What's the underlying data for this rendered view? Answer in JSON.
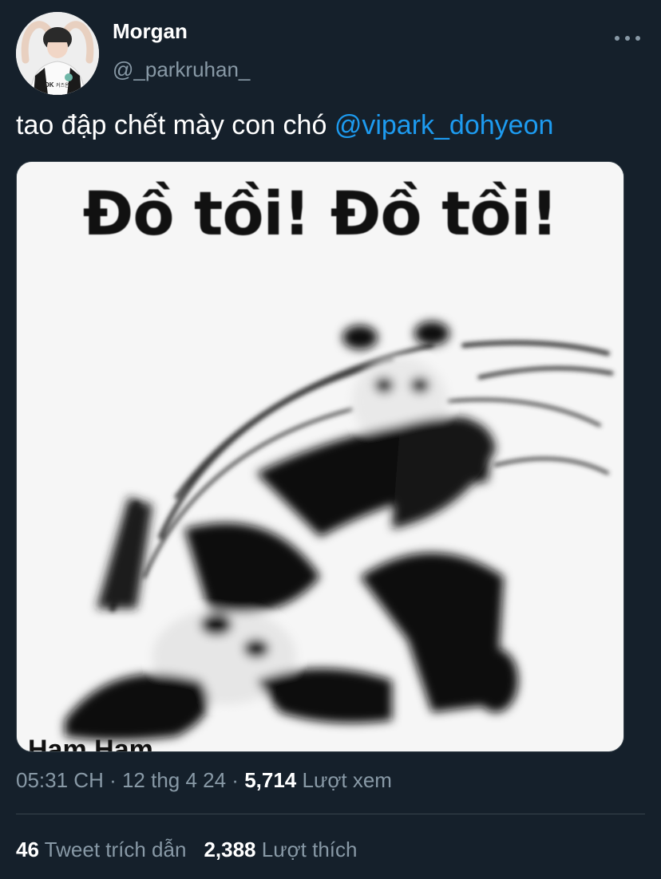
{
  "author": {
    "display_name": "Morgan",
    "handle": "@_parkruhan_",
    "avatar_jersey_text": "DK",
    "avatar_jersey_name": "커즈온"
  },
  "more_icon": "more-horizontal-icon",
  "tweet": {
    "text": "tao đập chết mày con chó ",
    "mention": "@vipark_dohyeon"
  },
  "media": {
    "caption": "Đồ tồi! Đồ tồi!",
    "watermark": "Ham Ham"
  },
  "meta": {
    "time": "05:31 CH",
    "separator1": " · ",
    "date": "12 thg 4 24",
    "separator2": " · ",
    "views_count": "5,714",
    "views_label": " Lượt xem"
  },
  "stats": {
    "quotes_count": "46",
    "quotes_label": " Tweet trích dẫn",
    "likes_count": "2,388",
    "likes_label": " Lượt thích"
  },
  "colors": {
    "background": "#15202b",
    "text": "#ffffff",
    "secondary": "#8899a6",
    "link": "#1d9bf0",
    "divider": "#38444d"
  }
}
